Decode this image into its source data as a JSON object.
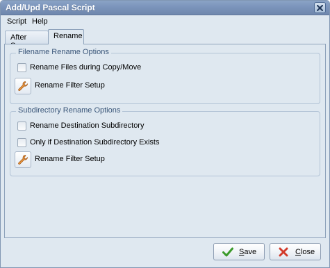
{
  "window": {
    "title": "Add/Upd Pascal Script"
  },
  "menu": {
    "items": [
      "Script",
      "Help"
    ]
  },
  "tabs": [
    {
      "label": "After Scan",
      "active": false
    },
    {
      "label": "Rename",
      "active": true
    }
  ],
  "filename_group": {
    "title": "Filename Rename Options",
    "rename_files_label": "Rename Files during Copy/Move",
    "rename_files_checked": false,
    "filter_setup_label": "Rename Filter Setup",
    "filter_setup_icon": "wrench-icon"
  },
  "subdir_group": {
    "title": "Subdirectory Rename Options",
    "rename_dest_label": "Rename Destination Subdirectory",
    "rename_dest_checked": false,
    "only_if_exists_label": "Only if Destination Subdirectory Exists",
    "only_if_exists_checked": false,
    "filter_setup_label": "Rename Filter Setup",
    "filter_setup_icon": "wrench-icon"
  },
  "footer": {
    "save_first": "S",
    "save_rest": "ave",
    "close_first": "C",
    "close_rest": "lose",
    "save_icon": "checkmark-icon",
    "close_icon": "red-x-icon"
  },
  "colors": {
    "titlebar": "#7b94bb",
    "window_bg": "#dfe8f0",
    "group_title": "#3a5679",
    "check_green": "#3a9a2a",
    "close_red": "#d23b2b"
  }
}
